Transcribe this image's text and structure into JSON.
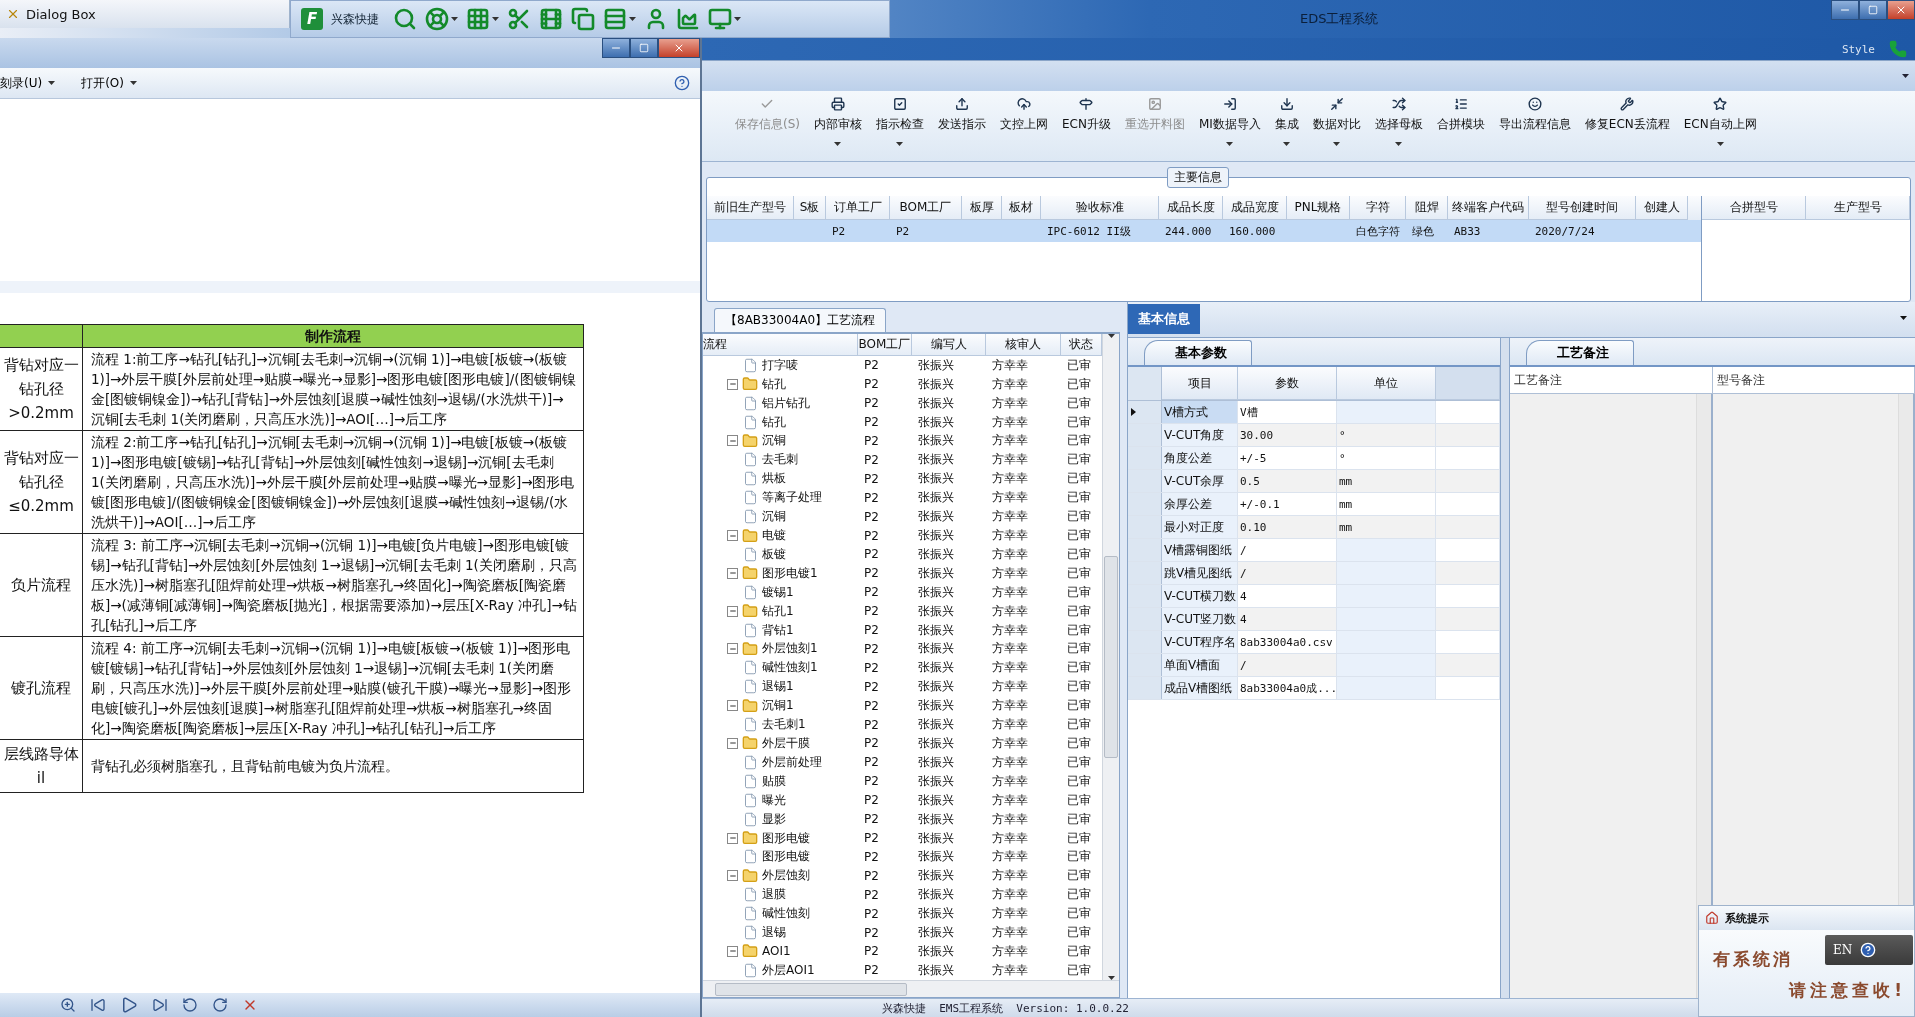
{
  "taskbar": {
    "title": "Dialog Box"
  },
  "quickbar": {
    "logo": "F",
    "title": "兴森快捷",
    "tools": [
      {
        "kind": "search",
        "dropdown": false
      },
      {
        "kind": "lifebuoy",
        "dropdown": true
      },
      {
        "kind": "table",
        "dropdown": true
      },
      {
        "kind": "scissors",
        "dropdown": false
      },
      {
        "kind": "film",
        "dropdown": false
      },
      {
        "kind": "copy",
        "dropdown": false
      },
      {
        "kind": "rows",
        "dropdown": true
      },
      {
        "kind": "user",
        "dropdown": false
      },
      {
        "kind": "chart",
        "dropdown": false
      },
      {
        "kind": "monitor",
        "dropdown": true
      }
    ]
  },
  "app": {
    "title": "EDS工程系统",
    "style_label": "Style"
  },
  "dialog": {
    "menus": [
      {
        "label": "刻录(U)"
      },
      {
        "label": "打开(O)"
      }
    ],
    "doc_table": {
      "header": "制作流程",
      "rows": [
        {
          "condition": "背钻对应一钻孔径>0.2mm",
          "flow": "流程 1:前工序→钻孔[钻孔]→沉铜[去毛刺→沉铜→(沉铜 1)]→电镀[板镀→(板镀 1)]→外层干膜[外层前处理→贴膜→曝光→显影]→图形电镀[图形电镀]/(图镀铜镍金[图镀铜镍金])→钻孔[背钻]→外层蚀刻[退膜→碱性蚀刻→退锡/(水洗烘干)]→沉铜[去毛刺 1(关闭磨刷，只高压水洗)]→AOI[…]→后工序"
        },
        {
          "condition": "背钻对应一钻孔径≤0.2mm",
          "flow": "流程 2:前工序→钻孔[钻孔]→沉铜[去毛刺→沉铜→(沉铜 1)]→电镀[板镀→(板镀 1)]→图形电镀[镀锡]→钻孔[背钻]→外层蚀刻[碱性蚀刻→退锡]→沉铜[去毛刺 1(关闭磨刷，只高压水洗)]→外层干膜[外层前处理→贴膜→曝光→显影]→图形电镀[图形电镀]/(图镀铜镍金[图镀铜镍金])→外层蚀刻[退膜→碱性蚀刻→退锡/(水洗烘干)]→AOI[…]→后工序"
        },
        {
          "condition": "负片流程",
          "flow": "流程 3: 前工序→沉铜[去毛刺→沉铜→(沉铜 1)]→电镀[负片电镀]→图形电镀[镀锡]→钻孔[背钻]→外层蚀刻[外层蚀刻 1→退锡]→沉铜[去毛刺 1(关闭磨刷，只高压水洗)]→树脂塞孔[阻焊前处理→烘板→树脂塞孔→终固化]→陶瓷磨板[陶瓷磨板]→(减薄铜[减薄铜]→陶瓷磨板[抛光]，根据需要添加)→层压[X-Ray 冲孔]→钻孔[钻孔]→后工序"
        },
        {
          "condition": "镀孔流程",
          "flow": "流程 4: 前工序→沉铜[去毛刺→沉铜→(沉铜 1)]→电镀[板镀→(板镀 1)]→图形电镀[镀锡]→钻孔[背钻]→外层蚀刻[外层蚀刻 1→退锡]→沉铜[去毛刺 1(关闭磨刷，只高压水洗)]→外层干膜[外层前处理→贴膜(镀孔干膜)→曝光→显影]→图形电镀[镀孔]→外层蚀刻[退膜]→树脂塞孔[阻焊前处理→烘板→树脂塞孔→终固化]→陶瓷磨板[陶瓷磨板]→层压[X-Ray 冲孔]→钻孔[钻孔]→后工序"
        },
        {
          "condition": "层线路导体\nil",
          "flow": "背钻孔必须树脂塞孔，且背钻前电镀为负片流程。"
        }
      ]
    }
  },
  "ribbon": {
    "buttons": [
      {
        "label": "保存信息(S)",
        "kind": "check",
        "disabled": true,
        "dropdown": false
      },
      {
        "label": "内部审核",
        "kind": "printer",
        "disabled": false,
        "dropdown": true
      },
      {
        "label": "指示检查",
        "kind": "checkbox",
        "disabled": false,
        "dropdown": true
      },
      {
        "label": "发送指示",
        "kind": "upload",
        "disabled": false,
        "dropdown": false
      },
      {
        "label": "文控上网",
        "kind": "cloud",
        "disabled": false,
        "dropdown": false
      },
      {
        "label": "ECN升级",
        "kind": "road",
        "disabled": false,
        "dropdown": false
      },
      {
        "label": "重选开料图",
        "kind": "image",
        "disabled": true,
        "dropdown": false
      },
      {
        "label": "MI数据导入",
        "kind": "import",
        "disabled": false,
        "dropdown": true
      },
      {
        "label": "集成",
        "kind": "download",
        "disabled": false,
        "dropdown": true
      },
      {
        "label": "数据对比",
        "kind": "shrink",
        "disabled": false,
        "dropdown": true
      },
      {
        "label": "选择母板",
        "kind": "shuffle",
        "disabled": false,
        "dropdown": true
      },
      {
        "label": "合拼模块",
        "kind": "list",
        "disabled": false,
        "dropdown": false
      },
      {
        "label": "导出流程信息",
        "kind": "smile",
        "disabled": false,
        "dropdown": false
      },
      {
        "label": "修复ECN丢流程",
        "kind": "wrench",
        "disabled": false,
        "dropdown": false
      },
      {
        "label": "ECN自动上网",
        "kind": "star",
        "disabled": false,
        "dropdown": true
      }
    ]
  },
  "main_info": {
    "legend": "主要信息",
    "columns": [
      "前旧生产型号",
      "S板",
      "订单工厂",
      "BOM工厂",
      "板厚",
      "板材",
      "验收标准",
      "成品长度",
      "成品宽度",
      "PNL规格",
      "字符",
      "阻焊",
      "终端客户代码",
      "型号创建时间",
      "创建人"
    ],
    "rows": [
      {
        "selected": true,
        "cells": [
          null,
          null,
          "P2",
          "P2",
          null,
          null,
          "IPC-6012 II级",
          "244.000",
          "160.000",
          null,
          "白色字符",
          "绿色",
          "AB33",
          "2020/7/24",
          null
        ]
      }
    ],
    "side_columns": [
      "合拼型号",
      "生产型号"
    ]
  },
  "flow_panel": {
    "tab": "【8AB33004A0】工艺流程",
    "columns": [
      "流程",
      "BOM工厂",
      "编写人",
      "核审人",
      "状态"
    ],
    "continued": [
      {
        "name": "打字唛",
        "bom": "P2",
        "writer": "张振兴",
        "reviewer": "方幸幸",
        "status": "已审"
      }
    ],
    "groups": [
      {
        "name": "钻孔",
        "bom": "P2",
        "writer": "张振兴",
        "reviewer": "方幸幸",
        "status": "已审",
        "expanded": true,
        "children": [
          {
            "name": "铝片钻孔",
            "bom": "P2",
            "writer": "张振兴",
            "reviewer": "方幸幸",
            "status": "已审"
          },
          {
            "name": "钻孔",
            "bom": "P2",
            "writer": "张振兴",
            "reviewer": "方幸幸",
            "status": "已审"
          }
        ]
      },
      {
        "name": "沉铜",
        "bom": "P2",
        "writer": "张振兴",
        "reviewer": "方幸幸",
        "status": "已审",
        "expanded": true,
        "children": [
          {
            "name": "去毛刺",
            "bom": "P2",
            "writer": "张振兴",
            "reviewer": "方幸幸",
            "status": "已审"
          },
          {
            "name": "烘板",
            "bom": "P2",
            "writer": "张振兴",
            "reviewer": "方幸幸",
            "status": "已审"
          },
          {
            "name": "等离子处理",
            "bom": "P2",
            "writer": "张振兴",
            "reviewer": "方幸幸",
            "status": "已审"
          },
          {
            "name": "沉铜",
            "bom": "P2",
            "writer": "张振兴",
            "reviewer": "方幸幸",
            "status": "已审"
          }
        ]
      },
      {
        "name": "电镀",
        "bom": "P2",
        "writer": "张振兴",
        "reviewer": "方幸幸",
        "status": "已审",
        "expanded": true,
        "children": [
          {
            "name": "板镀",
            "bom": "P2",
            "writer": "张振兴",
            "reviewer": "方幸幸",
            "status": "已审"
          }
        ]
      },
      {
        "name": "图形电镀1",
        "bom": "P2",
        "writer": "张振兴",
        "reviewer": "方幸幸",
        "status": "已审",
        "expanded": true,
        "children": [
          {
            "name": "镀锡1",
            "bom": "P2",
            "writer": "张振兴",
            "reviewer": "方幸幸",
            "status": "已审"
          }
        ]
      },
      {
        "name": "钻孔1",
        "bom": "P2",
        "writer": "张振兴",
        "reviewer": "方幸幸",
        "status": "已审",
        "expanded": true,
        "children": [
          {
            "name": "背钻1",
            "bom": "P2",
            "writer": "张振兴",
            "reviewer": "方幸幸",
            "status": "已审"
          }
        ]
      },
      {
        "name": "外层蚀刻1",
        "bom": "P2",
        "writer": "张振兴",
        "reviewer": "方幸幸",
        "status": "已审",
        "expanded": true,
        "children": [
          {
            "name": "碱性蚀刻1",
            "bom": "P2",
            "writer": "张振兴",
            "reviewer": "方幸幸",
            "status": "已审"
          },
          {
            "name": "退锡1",
            "bom": "P2",
            "writer": "张振兴",
            "reviewer": "方幸幸",
            "status": "已审"
          }
        ]
      },
      {
        "name": "沉铜1",
        "bom": "P2",
        "writer": "张振兴",
        "reviewer": "方幸幸",
        "status": "已审",
        "expanded": true,
        "children": [
          {
            "name": "去毛刺1",
            "bom": "P2",
            "writer": "张振兴",
            "reviewer": "方幸幸",
            "status": "已审"
          }
        ]
      },
      {
        "name": "外层干膜",
        "bom": "P2",
        "writer": "张振兴",
        "reviewer": "方幸幸",
        "status": "已审",
        "expanded": true,
        "children": [
          {
            "name": "外层前处理",
            "bom": "P2",
            "writer": "张振兴",
            "reviewer": "方幸幸",
            "status": "已审"
          },
          {
            "name": "贴膜",
            "bom": "P2",
            "writer": "张振兴",
            "reviewer": "方幸幸",
            "status": "已审"
          },
          {
            "name": "曝光",
            "bom": "P2",
            "writer": "张振兴",
            "reviewer": "方幸幸",
            "status": "已审"
          },
          {
            "name": "显影",
            "bom": "P2",
            "writer": "张振兴",
            "reviewer": "方幸幸",
            "status": "已审"
          }
        ]
      },
      {
        "name": "图形电镀",
        "bom": "P2",
        "writer": "张振兴",
        "reviewer": "方幸幸",
        "status": "已审",
        "expanded": true,
        "children": [
          {
            "name": "图形电镀",
            "bom": "P2",
            "writer": "张振兴",
            "reviewer": "方幸幸",
            "status": "已审"
          }
        ]
      },
      {
        "name": "外层蚀刻",
        "bom": "P2",
        "writer": "张振兴",
        "reviewer": "方幸幸",
        "status": "已审",
        "expanded": true,
        "children": [
          {
            "name": "退膜",
            "bom": "P2",
            "writer": "张振兴",
            "reviewer": "方幸幸",
            "status": "已审"
          },
          {
            "name": "碱性蚀刻",
            "bom": "P2",
            "writer": "张振兴",
            "reviewer": "方幸幸",
            "status": "已审"
          },
          {
            "name": "退锡",
            "bom": "P2",
            "writer": "张振兴",
            "reviewer": "方幸幸",
            "status": "已审"
          }
        ]
      },
      {
        "name": "AOI1",
        "bom": "P2",
        "writer": "张振兴",
        "reviewer": "方幸幸",
        "status": "已审",
        "expanded": true,
        "children": [
          {
            "name": "外层AOI1",
            "bom": "P2",
            "writer": "张振兴",
            "reviewer": "方幸幸",
            "status": "已审"
          }
        ]
      }
    ]
  },
  "basic_info": {
    "tab": "基本信息",
    "params_tab": "基本参数",
    "columns": [
      "项目",
      "参数",
      "单位"
    ],
    "rows": [
      {
        "item": "V槽方式",
        "value": "V槽",
        "unit": null,
        "selected": true
      },
      {
        "item": "V-CUT角度",
        "value": "30.00",
        "unit": "°",
        "selected": false
      },
      {
        "item": "角度公差",
        "value": "+/-5",
        "unit": "°",
        "selected": false
      },
      {
        "item": "V-CUT余厚",
        "value": "0.5",
        "unit": "mm",
        "selected": false
      },
      {
        "item": "余厚公差",
        "value": "+/-0.1",
        "unit": "mm",
        "selected": false
      },
      {
        "item": "最小对正度",
        "value": "0.10",
        "unit": "mm",
        "selected": false
      },
      {
        "item": "V槽露铜图纸",
        "value": "/",
        "unit": null,
        "selected": false
      },
      {
        "item": "跳V槽见图纸",
        "value": "/",
        "unit": null,
        "selected": false
      },
      {
        "item": "V-CUT横刀数",
        "value": "4",
        "unit": null,
        "selected": false
      },
      {
        "item": "V-CUT竖刀数",
        "value": "4",
        "unit": null,
        "selected": false
      },
      {
        "item": "V-CUT程序名",
        "value": "8ab33004a0.csv",
        "unit": null,
        "selected": false
      },
      {
        "item": "单面V槽面",
        "value": "/",
        "unit": null,
        "selected": false
      },
      {
        "item": "成品V槽图纸",
        "value": "8ab33004a0成...",
        "unit": null,
        "selected": false
      }
    ],
    "notes_tab": "工艺备注",
    "notes_columns": [
      "工艺备注",
      "型号备注"
    ]
  },
  "popup": {
    "title": "系统提示",
    "message": "有系统消",
    "message2": "请注意查收!"
  },
  "ime": {
    "label": "EN"
  },
  "status_bar": {
    "text": "兴森快捷  EMS工程系统  Version: 1.0.0.22"
  }
}
